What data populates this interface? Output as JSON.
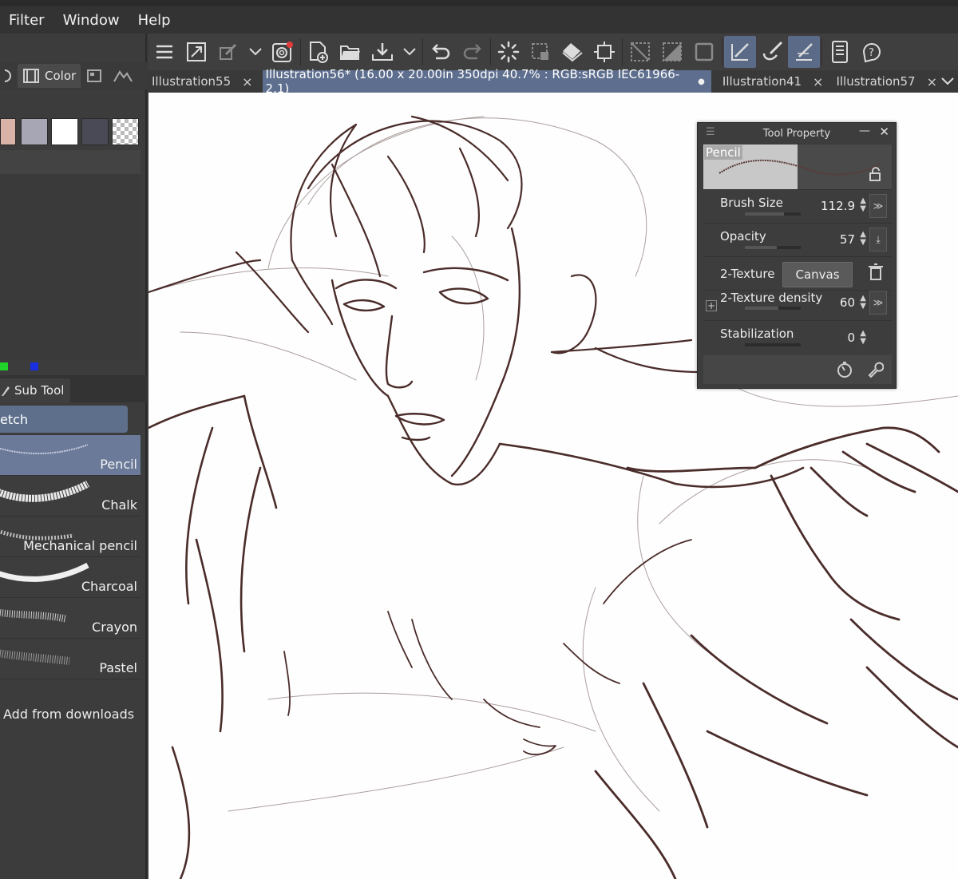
{
  "menubar": {
    "items": [
      "Filter",
      "Window",
      "Help"
    ]
  },
  "left_panel": {
    "tabs": [
      {
        "label": "Color",
        "icon": "film-strip-icon"
      }
    ],
    "swatch_colors": [
      "#d9b3a8",
      "#a7a6b5",
      "#ffffff",
      "#4a4a56",
      "transparent-checker"
    ],
    "rgb_indicator_colors": [
      "#1fd42a",
      "#1a2fe0"
    ]
  },
  "sub_tool": {
    "tab_label": "Sub Tool",
    "group_label": "etch",
    "brushes": [
      {
        "name": "Pencil",
        "active": true
      },
      {
        "name": "Chalk",
        "active": false
      },
      {
        "name": "Mechanical pencil",
        "active": false
      },
      {
        "name": "Charcoal",
        "active": false
      },
      {
        "name": "Crayon",
        "active": false
      },
      {
        "name": "Pastel",
        "active": false
      }
    ],
    "add_from_downloads": "Add from downloads"
  },
  "toolbar": {
    "icons": [
      "hamburger-menu-icon",
      "expand-icon",
      "transform-brush-icon",
      "dropdown-chevron-icon",
      "spiral-app-icon",
      "new-document-icon",
      "open-folder-icon",
      "save-tray-icon",
      "dropdown-chevron-icon",
      "undo-icon",
      "redo-icon",
      "loading-spinner-icon",
      "selection-launcher-icon",
      "fill-bucket-icon",
      "crop-transform-icon",
      "deselect-icon",
      "invert-selection-icon",
      "selection-outline-icon",
      "snap-ruler-icon",
      "brush-stroke-icon",
      "perspective-ruler-icon",
      "device-panel-icon",
      "help-icon"
    ]
  },
  "document_tabs": [
    {
      "label": "Illustration55",
      "active": false,
      "marker": "×"
    },
    {
      "label": "Illustration56* (16.00 x 20.00in 350dpi 40.7% : RGB:sRGB IEC61966-2.1)",
      "active": true,
      "marker": "●"
    },
    {
      "label": "Illustration41",
      "active": false,
      "marker": "×"
    },
    {
      "label": "Illustration57",
      "active": false,
      "marker": "×"
    }
  ],
  "tool_property": {
    "title": "Tool Property",
    "brush_name": "Pencil",
    "rows": [
      {
        "label": "Brush Size",
        "value": "112.9",
        "level": 0.7
      },
      {
        "label": "Opacity",
        "value": "57",
        "level": 0.57
      },
      {
        "label": "2-Texture",
        "button": "Canvas"
      },
      {
        "label": "2-Texture density",
        "value": "60",
        "level": 0.6
      },
      {
        "label": "Stabilization",
        "value": "0",
        "level": 0.0
      }
    ]
  },
  "colors": {
    "accent": "#5d6e8e",
    "active_brush_bg": "#6a7a98",
    "ink": "#4a2c2a"
  }
}
